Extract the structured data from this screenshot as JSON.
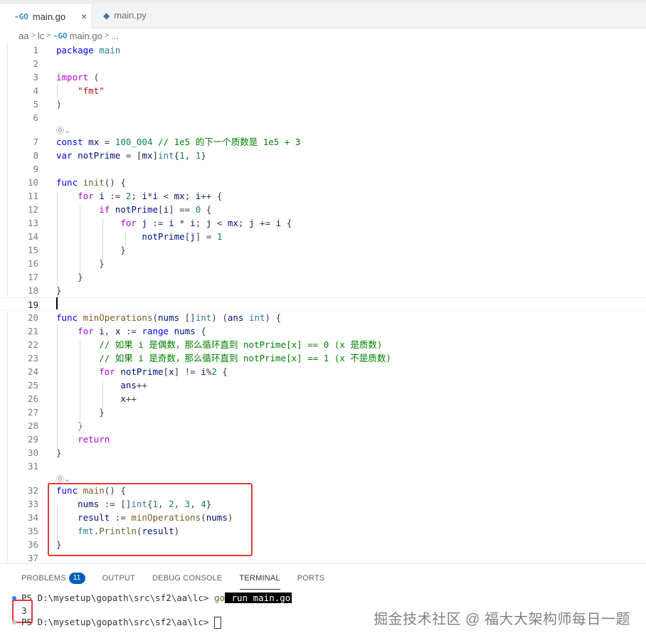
{
  "tabs": [
    {
      "label": "main.go",
      "active": true,
      "close": "×"
    },
    {
      "label": "main.py",
      "active": false
    }
  ],
  "breadcrumb": {
    "items": [
      "aa",
      "lc",
      "main.go",
      "..."
    ],
    "sep": ">"
  },
  "icons": {
    "go": "-GO",
    "py": "◆",
    "lens": "⓪⌄"
  },
  "code_lens": "⓪⌄",
  "lines": [
    {
      "n": "1",
      "html": "<span class='kw'>package</span> <span class='ty'>main</span>"
    },
    {
      "n": "2",
      "html": ""
    },
    {
      "n": "3",
      "html": "<span class='kw2'>import</span> ("
    },
    {
      "n": "4",
      "html": "    <span class='str'>\"fmt\"</span>"
    },
    {
      "n": "5",
      "html": ")"
    },
    {
      "n": "6",
      "html": ""
    },
    {
      "n": "7",
      "html": "<span class='kw'>const</span> <span class='var'>mx</span> = <span class='num'>100_004</span> <span class='cm'>// 1e5 的下一个质数是 1e5 + 3</span>"
    },
    {
      "n": "8",
      "html": "<span class='kw'>var</span> <span class='var'>notPrime</span> = [<span class='var'>mx</span>]<span class='ty'>int</span>{<span class='num'>1</span>, <span class='num'>1</span>}"
    },
    {
      "n": "9",
      "html": ""
    },
    {
      "n": "10",
      "html": "<span class='kw'>func</span> <span class='fn'>init</span>() {"
    },
    {
      "n": "11",
      "html": "    <span class='kw2'>for</span> <span class='var'>i</span> := <span class='num'>2</span>; <span class='var'>i</span>*<span class='var'>i</span> &lt; <span class='var'>mx</span>; <span class='var'>i</span>++ {"
    },
    {
      "n": "12",
      "html": "        <span class='kw2'>if</span> <span class='var'>notPrime</span>[<span class='var'>i</span>] == <span class='num'>0</span> {"
    },
    {
      "n": "13",
      "html": "            <span class='kw2'>for</span> <span class='var'>j</span> := <span class='var'>i</span> * <span class='var'>i</span>; <span class='var'>j</span> &lt; <span class='var'>mx</span>; <span class='var'>j</span> += <span class='var'>i</span> {"
    },
    {
      "n": "14",
      "html": "                <span class='var'>notPrime</span>[<span class='var'>j</span>] = <span class='num'>1</span>"
    },
    {
      "n": "15",
      "html": "            }"
    },
    {
      "n": "16",
      "html": "        }"
    },
    {
      "n": "17",
      "html": "    }"
    },
    {
      "n": "18",
      "html": "}"
    },
    {
      "n": "19",
      "html": ""
    },
    {
      "n": "20",
      "html": "<span class='kw'>func</span> <span class='fn'>minOperations</span>(<span class='var'>nums</span> []<span class='ty'>int</span>) (<span class='var'>ans</span> <span class='ty'>int</span>) {"
    },
    {
      "n": "21",
      "html": "    <span class='kw2'>for</span> <span class='var'>i</span>, <span class='var'>x</span> := <span class='kw'>range</span> <span class='var'>nums</span> {"
    },
    {
      "n": "22",
      "html": "        <span class='cm'>// 如果 i 是偶数，那么循环直到 notPrime[x] == 0 (x 是质数)</span>"
    },
    {
      "n": "23",
      "html": "        <span class='cm'>// 如果 i 是奇数，那么循环直到 notPrime[x] == 1 (x 不是质数)</span>"
    },
    {
      "n": "24",
      "html": "        <span class='kw2'>for</span> <span class='var'>notPrime</span>[<span class='var'>x</span>] != <span class='var'>i</span>%<span class='num'>2</span> {"
    },
    {
      "n": "25",
      "html": "            <span class='var'>ans</span>++"
    },
    {
      "n": "26",
      "html": "            <span class='var'>x</span>++"
    },
    {
      "n": "27",
      "html": "        }"
    },
    {
      "n": "28",
      "html": "    }"
    },
    {
      "n": "29",
      "html": "    <span class='kw2'>return</span>"
    },
    {
      "n": "30",
      "html": "}"
    },
    {
      "n": "31",
      "html": ""
    },
    {
      "n": "32",
      "html": "<span class='kw'>func</span> <span class='fn'>main</span>() {"
    },
    {
      "n": "33",
      "html": "    <span class='var'>nums</span> := []<span class='ty'>int</span>{<span class='num'>1</span>, <span class='num'>2</span>, <span class='num'>3</span>, <span class='num'>4</span>}"
    },
    {
      "n": "34",
      "html": "    <span class='var'>result</span> := <span class='fn'>minOperations</span>(<span class='var'>nums</span>)"
    },
    {
      "n": "35",
      "html": "    <span class='pkg'>fmt</span>.<span class='fn'>Println</span>(<span class='var'>result</span>)"
    },
    {
      "n": "36",
      "html": "}"
    },
    {
      "n": "37",
      "html": ""
    }
  ],
  "panel": {
    "tabs": [
      "PROBLEMS",
      "OUTPUT",
      "DEBUG CONSOLE",
      "TERMINAL",
      "PORTS"
    ],
    "problems_count": "11",
    "active_tab": "TERMINAL"
  },
  "terminal": {
    "prompt1": "PS D:\\mysetup\\gopath\\src\\sf2\\aa\\lc> ",
    "cmd_go": "go",
    "cmd_rest": " run main.go",
    "output": "3",
    "prompt2": "PS D:\\mysetup\\gopath\\src\\sf2\\aa\\lc> "
  },
  "watermark": "掘金技术社区 @ 福大大架构师每日一题",
  "colors": {
    "highlight": "#e53935",
    "accent": "#005fb8"
  }
}
